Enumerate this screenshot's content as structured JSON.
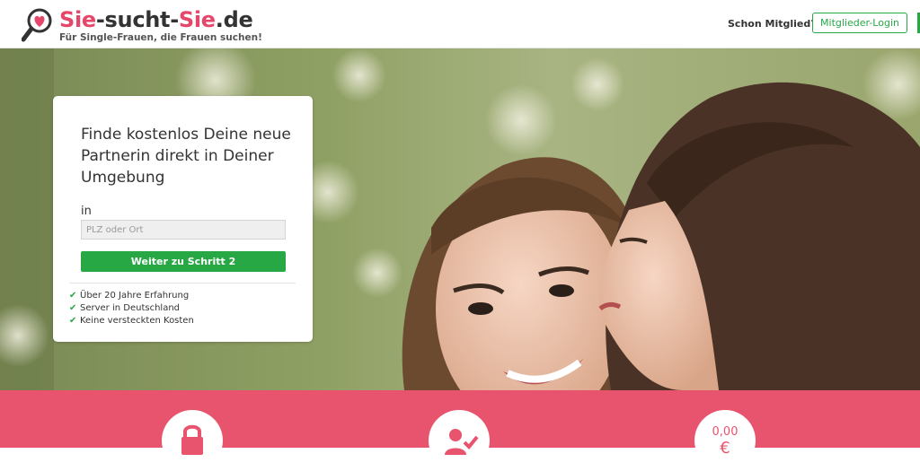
{
  "header": {
    "logo_part1": "Sie",
    "logo_part2": "-sucht-",
    "logo_part3": "Sie",
    "logo_part4": ".de",
    "tagline": "Für Single-Frauen, die Frauen suchen!",
    "member_question": "Schon Mitglied?",
    "login_label": "Mitglieder-Login"
  },
  "card": {
    "title": "Finde kostenlos Deine neue Partnerin direkt in Deiner Umgebung",
    "location_label": "in",
    "location_placeholder": "PLZ oder Ort",
    "submit_label": "Weiter zu Schritt 2",
    "features": [
      "Über 20 Jahre Erfahrung",
      "Server in Deutschland",
      "Keine versteckten Kosten"
    ]
  },
  "band": {
    "price_value": "0,00",
    "price_currency": "€"
  },
  "icons": {
    "logo": "magnifier-heart-icon",
    "check": "check-icon",
    "lock": "lock-icon",
    "person": "person-check-icon"
  },
  "colors": {
    "brand_pink": "#e5476a",
    "band_pink": "#e8536e",
    "accent_green": "#28a745"
  }
}
